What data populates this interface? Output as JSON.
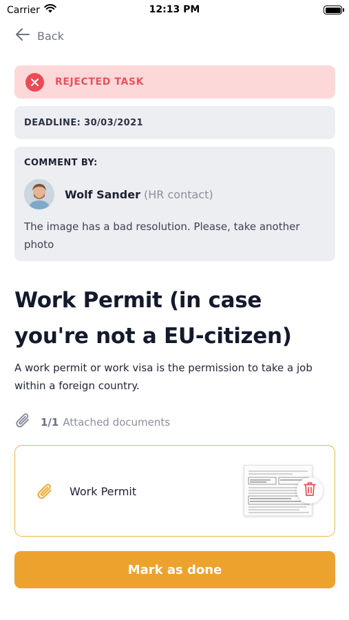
{
  "status_bar": {
    "carrier": "Carrier",
    "time": "12:13 PM"
  },
  "nav": {
    "back_label": "Back"
  },
  "task_status": {
    "label": "REJECTED TASK",
    "color": "#ec4a55"
  },
  "deadline": {
    "text": "DEADLINE: 30/03/2021"
  },
  "comment": {
    "header": "COMMENT BY:",
    "author_name": "Wolf Sander",
    "author_role": "(HR contact)",
    "text": "The image has a bad resolution. Please, take another photo"
  },
  "task": {
    "title": "Work Permit (in case you're not a EU-citizen)",
    "description": "A work permit or work visa is the permission to take a job within a foreign country."
  },
  "attachments": {
    "count": "1/1",
    "label": "Attached documents",
    "items": [
      {
        "name": "Work Permit"
      }
    ]
  },
  "actions": {
    "mark_done_label": "Mark as done"
  },
  "colors": {
    "accent": "#eda22e",
    "rejected_bg": "#fcd8d9",
    "card_bg": "#edeef1"
  },
  "icons": [
    "wifi-icon",
    "battery-icon",
    "back-arrow-icon",
    "close-icon",
    "paperclip-icon",
    "trash-icon"
  ]
}
